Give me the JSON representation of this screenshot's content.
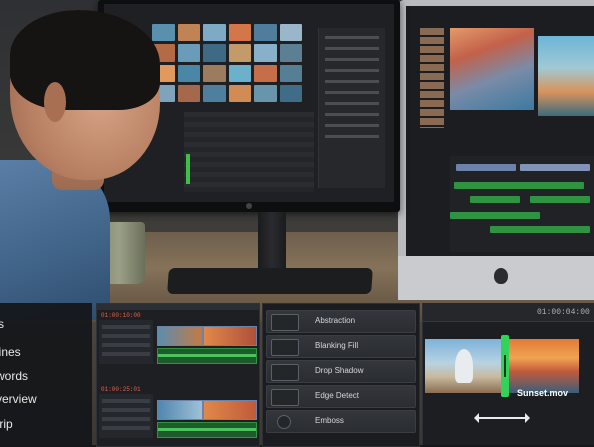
{
  "menu": {
    "items": [
      "s",
      "lines",
      "words",
      "verview",
      "trip"
    ]
  },
  "timeline": {
    "timecode_top": "01:00:10:00",
    "timecode_bottom": "01:00:25:01"
  },
  "effects": {
    "items": [
      "Abstraction",
      "Blanking Fill",
      "Drop Shadow",
      "Edge Detect",
      "Emboss"
    ]
  },
  "trim": {
    "ruler_label": "01:00:04:00",
    "clip_name": "Sunset.mov"
  },
  "colors": {
    "accent_green": "#33d35a",
    "timecode_red": "#e2604a",
    "panel_dark": "#1c1e21"
  }
}
